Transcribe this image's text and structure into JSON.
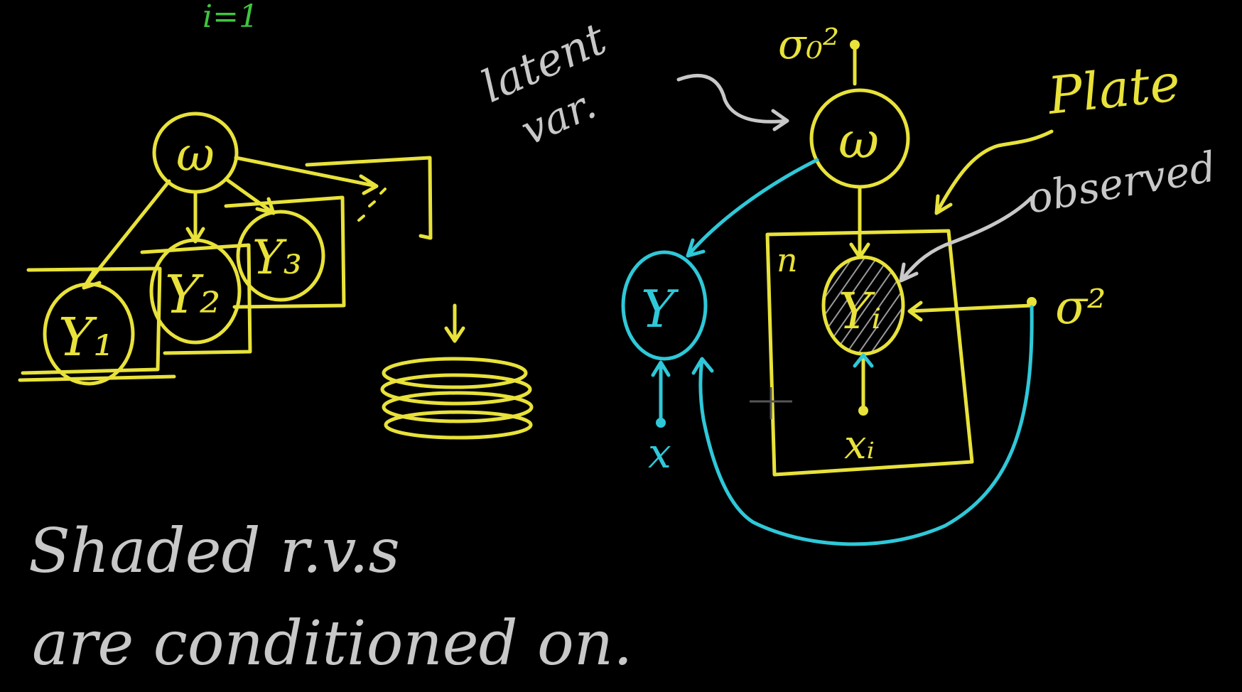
{
  "colors": {
    "background": "#000000",
    "yellow": "#e8e23a",
    "cyan": "#2fc8d8",
    "gray": "#c8c8c8",
    "green": "#3ec63e"
  },
  "top_fragment": "i=1",
  "left_graph": {
    "w_label": "ω",
    "y1_label": "Y₁",
    "y2_label": "Y₂",
    "y3_label": "Y₃",
    "dots": "..."
  },
  "latent_annotation": {
    "line1": "latent",
    "line2": "var."
  },
  "right_graph": {
    "w_label": "ω",
    "sigma0_label": "σ₀²",
    "y_label": "Y",
    "x_label": "x",
    "yi_label": "Yᵢ",
    "xi_label": "xᵢ",
    "plate_n": "n",
    "sigma_label": "σ²"
  },
  "plate_annotation": "Plate",
  "observed_annotation": "observed",
  "note": {
    "line1": "Shaded r.v.s",
    "line2": "are conditioned on."
  }
}
